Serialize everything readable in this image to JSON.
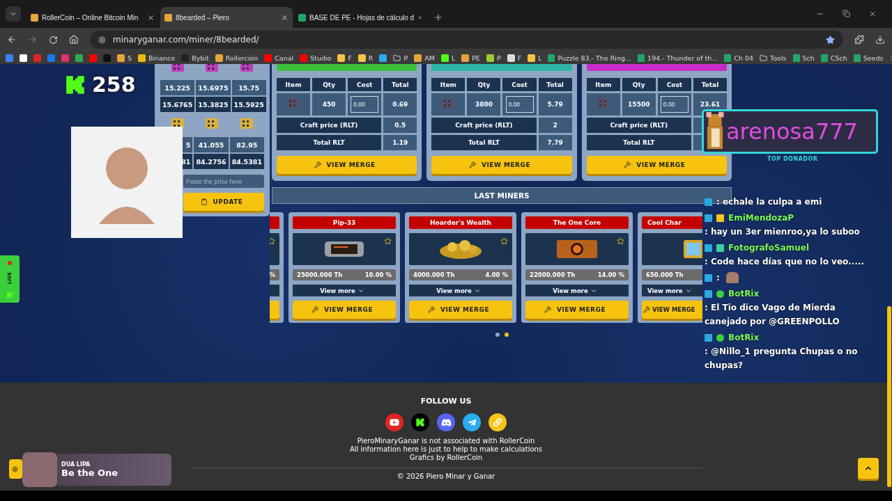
{
  "browser": {
    "tabs": [
      {
        "title": "RollerCoin – Online Bitcoin Min",
        "selected": false,
        "color": "#e8a33c"
      },
      {
        "title": "8bearded – Piero",
        "selected": true,
        "color": "#e8a33c"
      },
      {
        "title": "BASE DE PE - Hojas de cálculo d",
        "selected": false,
        "color": "#23a566"
      }
    ],
    "address": "minaryganar.com/miner/8bearded/",
    "bookmarks": [
      {
        "kind": "favicon",
        "color": "#3b82f6"
      },
      {
        "kind": "favicon",
        "color": "#ffffff"
      },
      {
        "kind": "favicon",
        "color": "#e02424"
      },
      {
        "kind": "favicon",
        "color": "#1877f2"
      },
      {
        "kind": "favicon",
        "color": "#e1306c"
      },
      {
        "kind": "favicon",
        "color": "#34a853"
      },
      {
        "kind": "favicon",
        "color": "#ff0000"
      },
      {
        "kind": "favicon",
        "color": "#111111"
      },
      {
        "kind": "favicon",
        "color": "#e8a33c",
        "label": "S"
      },
      {
        "kind": "favicon",
        "color": "#f0b90b",
        "label": "Binance"
      },
      {
        "kind": "favicon",
        "color": "#222222",
        "label": "Bybit"
      },
      {
        "kind": "favicon",
        "color": "#e8a33c",
        "label": "Rollercoin"
      },
      {
        "kind": "favicon",
        "color": "#ff0000",
        "label": "Canal"
      },
      {
        "kind": "favicon",
        "color": "#ff0000",
        "label": "Studio"
      },
      {
        "kind": "favicon",
        "color": "#f5c542",
        "label": "F"
      },
      {
        "kind": "favicon",
        "color": "#f5c542",
        "label": "R"
      },
      {
        "kind": "favicon",
        "color": "#2aabee"
      },
      {
        "kind": "folder",
        "label": "P"
      },
      {
        "kind": "favicon",
        "color": "#e8a33c",
        "label": "AM"
      },
      {
        "kind": "favicon",
        "color": "#53fc18",
        "label": "L"
      },
      {
        "kind": "favicon",
        "color": "#e8a33c",
        "label": "PE"
      },
      {
        "kind": "favicon",
        "color": "#9acd32",
        "label": "P"
      },
      {
        "kind": "favicon",
        "color": "#dddddd",
        "label": "F"
      },
      {
        "kind": "favicon",
        "color": "#f5c542",
        "label": "L"
      },
      {
        "kind": "sheet",
        "label": "Puzzle 83.- The Ring..."
      },
      {
        "kind": "sheet",
        "label": "194.- Thunder of th..."
      },
      {
        "kind": "sheet",
        "label": "Ch 04"
      },
      {
        "kind": "folder",
        "label": "Tools"
      },
      {
        "kind": "sheet",
        "label": "Sch"
      },
      {
        "kind": "sheet",
        "label": "CSch"
      },
      {
        "kind": "sheet",
        "label": "Seeds"
      }
    ]
  },
  "price_panel": {
    "groups": [
      {
        "color": "#c03cc0",
        "rows": [
          [
            "15.225",
            "15.6975",
            "15.75"
          ],
          [
            "15.6765",
            "15.3825",
            "15.5925"
          ]
        ]
      },
      {
        "color": "#d9b23c",
        "rows": [
          [
            "5",
            "41.055",
            "82.95"
          ],
          [
            "81",
            "84.2756",
            "84.5381"
          ]
        ]
      }
    ],
    "placeholder": "Paste the price here",
    "button": "UPDATE"
  },
  "merge_cards": [
    {
      "color": "#3cc03c",
      "columns": [
        "Item",
        "Qty",
        "Cost",
        "Total"
      ],
      "qty": "450",
      "cost": "0.00",
      "total": "0.69",
      "craft_label": "Craft price (RLT)",
      "craft_price": "0.5",
      "total_label": "Total RLT",
      "total_rlt": "1.19",
      "button": "VIEW MERGE"
    },
    {
      "color": "#2cb6a8",
      "columns": [
        "Item",
        "Qty",
        "Cost",
        "Total"
      ],
      "qty": "3800",
      "cost": "0.00",
      "total": "5.79",
      "craft_label": "Craft price (RLT)",
      "craft_price": "2",
      "total_label": "Total RLT",
      "total_rlt": "7.79",
      "button": "VIEW MERGE"
    },
    {
      "color": "#c82cc8",
      "columns": [
        "Item",
        "Qty",
        "Cost",
        "Total"
      ],
      "qty": "15500",
      "cost": "0.00",
      "total": "23.61",
      "craft_label": "Craft price (RLT)",
      "total_label": "Total RLT",
      "button": "VIEW MERGE"
    }
  ],
  "last_miners": {
    "title": "LAST MINERS",
    "cards": [
      {
        "share": "%"
      },
      {
        "name": "Pip-33",
        "power": "25000.000 Th",
        "share": "10.00 %",
        "more": "View more",
        "button": "VIEW MERGE",
        "kind": "device"
      },
      {
        "name": "Hoarder's Wealth",
        "power": "4000.000 Th",
        "share": "4.00 %",
        "more": "View more",
        "button": "VIEW MERGE",
        "kind": "gold"
      },
      {
        "name": "The One Core",
        "power": "22000.000 Th",
        "share": "14.00 %",
        "more": "View more",
        "button": "VIEW MERGE",
        "kind": "core"
      },
      {
        "name": "Cool Char",
        "power": "650.000 Th",
        "more": "View more",
        "button": "VIEW MERGE",
        "kind": "frame"
      }
    ],
    "dots": [
      {
        "selected": false
      },
      {
        "selected": true
      }
    ]
  },
  "footer": {
    "title": "FOLLOW US",
    "socials": [
      {
        "kind": "youtube",
        "color": "#e02424"
      },
      {
        "kind": "kick",
        "color": "#000000"
      },
      {
        "kind": "discord",
        "color": "#5865f2"
      },
      {
        "kind": "telegram",
        "color": "#2aabee"
      },
      {
        "kind": "link",
        "color": "#f5c518"
      }
    ],
    "lines": [
      "PieroMinaryGanar is not associated with RollerCoin",
      "All information here is just to help to make calculations",
      "Grafics by RollerCoin"
    ],
    "copyright": "© 2026 Piero Minar y Ganar"
  },
  "stream": {
    "kick_count": "258",
    "live": "LIVE",
    "donor": {
      "name": "arenosa777",
      "label": "TOP DONADOR"
    },
    "chat": [
      {
        "badges": [
          {
            "kind": "mod"
          }
        ],
        "text": ": echale la culpa a emi"
      },
      {
        "badges": [
          {
            "kind": "mod"
          },
          {
            "kind": "sub"
          }
        ],
        "user": "EmiMendozaP",
        "color": "#7cfc5c",
        "text": ": hay un 3er mienroo,ya lo suboo"
      },
      {
        "badges": [
          {
            "kind": "mod"
          },
          {
            "kind": "bits"
          }
        ],
        "user": "FotografoSamuel",
        "color": "#7cfc5c",
        "text": ": Code hace días que no lo veo....."
      },
      {
        "badges": [
          {
            "kind": "mod"
          }
        ],
        "text": ":",
        "emote": true
      },
      {
        "badges": [
          {
            "kind": "mod"
          },
          {
            "kind": "verified"
          }
        ],
        "user": "BotRix",
        "color": "#7cfc5c",
        "text": ": El Tio dice Vago de Mierda canejado por @GREENPOLLO"
      },
      {
        "badges": [
          {
            "kind": "mod"
          },
          {
            "kind": "verified"
          }
        ],
        "user": "BotRix",
        "color": "#7cfc5c",
        "text": ": @Nillo_1 pregunta Chupas o no chupas?"
      }
    ],
    "music": {
      "artist": "DUA LIPA",
      "song": "Be the One"
    }
  }
}
